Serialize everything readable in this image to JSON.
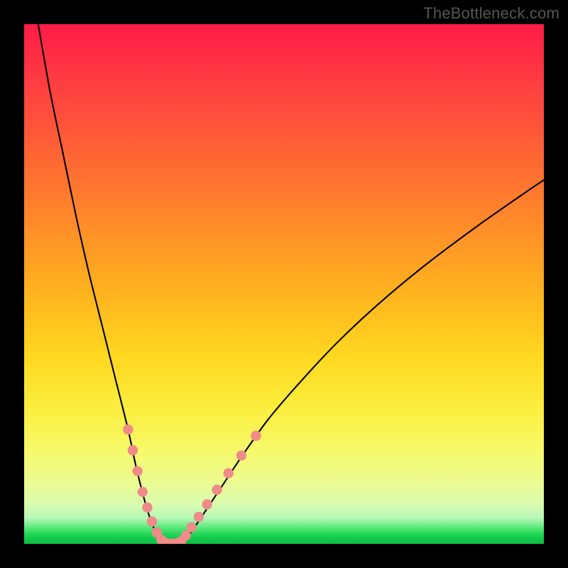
{
  "watermark_text": "TheBottleneck.com",
  "colors": {
    "page_bg": "#000000",
    "gradient_top": "#ff1c47",
    "gradient_mid": "#ffd820",
    "gradient_bottom": "#0fbe45",
    "curve_stroke": "#000000",
    "dot_fill": "#ef8b88"
  },
  "chart_data": {
    "type": "line",
    "title": "",
    "xlabel": "",
    "ylabel": "",
    "xlim": [
      0,
      100
    ],
    "ylim": [
      0,
      100
    ],
    "grid": false,
    "legend": false,
    "series": [
      {
        "name": "left-branch",
        "x": [
          2.7,
          5,
          7.5,
          10,
          12.5,
          15,
          17.5,
          20,
          21.5,
          23,
          24.2,
          25.2,
          26,
          26.6
        ],
        "y": [
          100,
          87,
          75,
          63,
          52,
          42,
          32,
          22,
          15,
          9,
          5,
          2.5,
          1,
          0.2
        ]
      },
      {
        "name": "flat-bottom",
        "x": [
          26.6,
          27.5,
          28.5,
          29.5,
          30.3
        ],
        "y": [
          0.2,
          0,
          0,
          0,
          0.2
        ]
      },
      {
        "name": "right-branch",
        "x": [
          30.3,
          31.5,
          33,
          35,
          38,
          42,
          47,
          53,
          60,
          68,
          77,
          87,
          97,
          100
        ],
        "y": [
          0.2,
          1.5,
          3.5,
          6.5,
          11,
          17,
          24,
          31,
          38.5,
          46,
          53.5,
          61,
          68,
          70
        ]
      }
    ],
    "markers": [
      {
        "x": 20.0,
        "y": 22.0
      },
      {
        "x": 20.9,
        "y": 18.0
      },
      {
        "x": 21.8,
        "y": 14.0
      },
      {
        "x": 22.8,
        "y": 10.0
      },
      {
        "x": 23.7,
        "y": 7.0
      },
      {
        "x": 24.6,
        "y": 4.3
      },
      {
        "x": 25.5,
        "y": 2.2
      },
      {
        "x": 26.4,
        "y": 0.8
      },
      {
        "x": 27.3,
        "y": 0.15
      },
      {
        "x": 28.3,
        "y": 0.0
      },
      {
        "x": 29.2,
        "y": 0.1
      },
      {
        "x": 30.2,
        "y": 0.5
      },
      {
        "x": 31.1,
        "y": 1.6
      },
      {
        "x": 32.2,
        "y": 3.2
      },
      {
        "x": 33.6,
        "y": 5.2
      },
      {
        "x": 35.2,
        "y": 7.6
      },
      {
        "x": 37.1,
        "y": 10.4
      },
      {
        "x": 39.3,
        "y": 13.6
      },
      {
        "x": 41.8,
        "y": 17.0
      },
      {
        "x": 44.6,
        "y": 20.8
      }
    ],
    "annotations": []
  }
}
